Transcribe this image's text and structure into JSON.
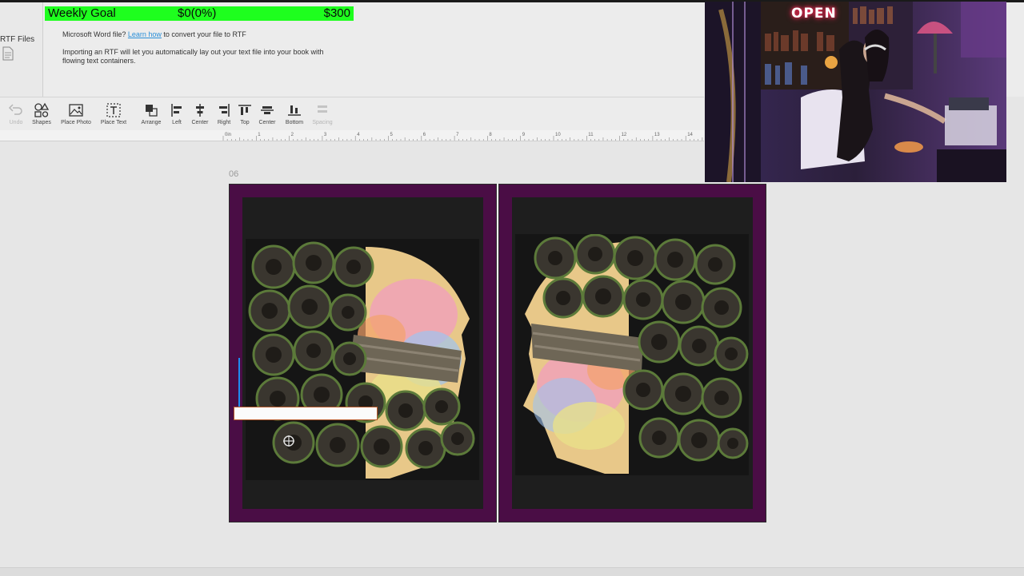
{
  "goal": {
    "title": "Weekly Goal",
    "current": "$0(0%)",
    "target": "$300",
    "progress_fraction": 0
  },
  "import_panel": {
    "side_label": "RTF Files",
    "word_prefix": "Microsoft Word file?",
    "learn_link": "Learn how",
    "word_suffix": "to convert your file to RTF",
    "rtf_info": "Importing an RTF will let you automatically lay out your text file into your book with flowing text containers."
  },
  "toolbar": {
    "undo": "Undo",
    "shapes": "Shapes",
    "place_photo": "Place Photo",
    "place_text": "Place Text",
    "arrange": "Arrange",
    "left": "Left",
    "center_h": "Center",
    "right": "Right",
    "top": "Top",
    "center_v": "Center",
    "bottom": "Bottom",
    "spacing": "Spacing"
  },
  "ruler": {
    "labels": [
      "0in",
      "1",
      "2",
      "3",
      "4",
      "5",
      "6",
      "7",
      "8",
      "9",
      "10",
      "11",
      "12",
      "13",
      "14"
    ]
  },
  "canvas": {
    "page_number": "06",
    "page_color": "#4a0d45"
  },
  "webcam": {
    "sign": "OPEN"
  },
  "colors": {
    "goal_bar": "#1eff1e",
    "link": "#2a8fd8",
    "selection_line": "#1e8cf0"
  }
}
